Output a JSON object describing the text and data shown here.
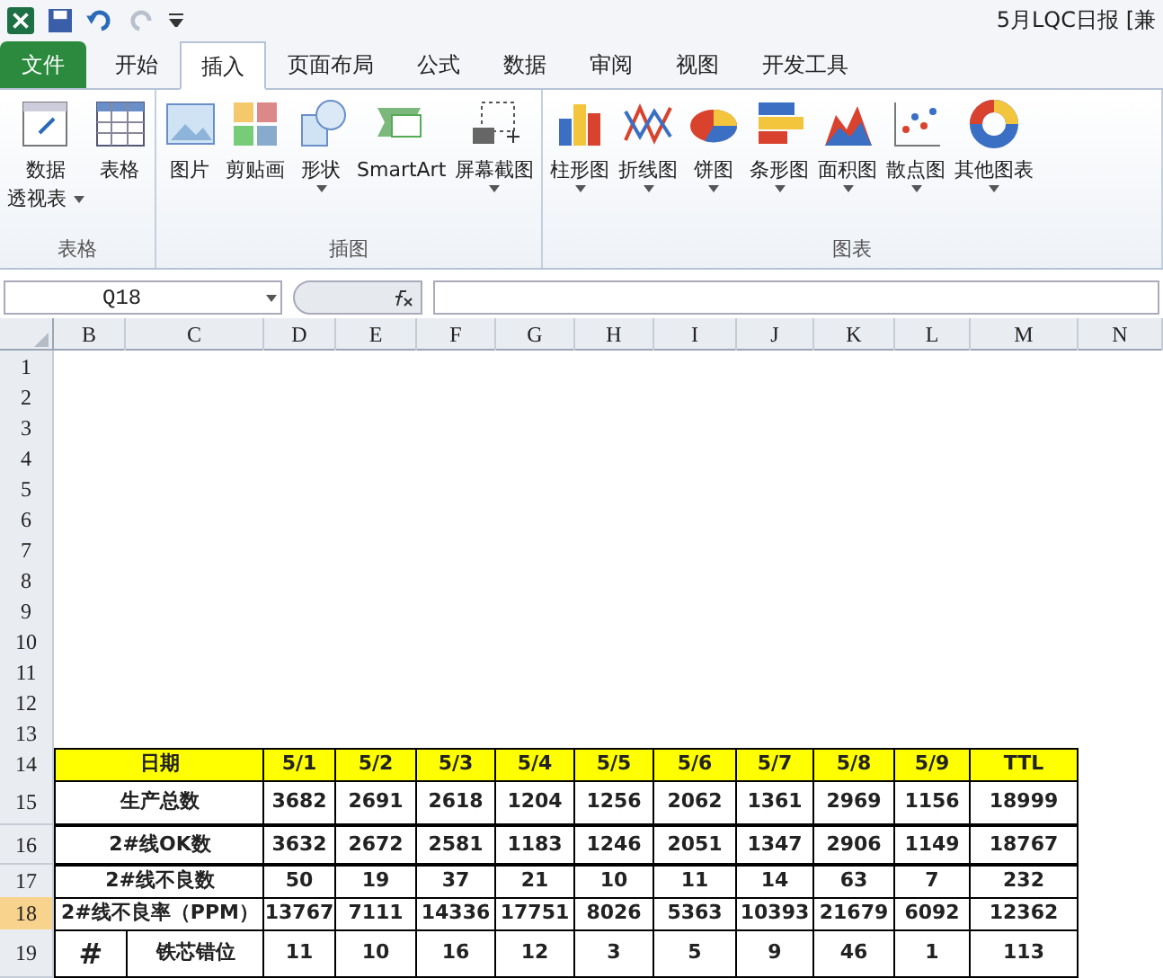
{
  "window": {
    "title": "5月LQC日报  [兼"
  },
  "tabs": [
    {
      "label": "文件",
      "kind": "file",
      "selected": false
    },
    {
      "label": "开始",
      "kind": "tab",
      "selected": false
    },
    {
      "label": "插入",
      "kind": "tab",
      "selected": true
    },
    {
      "label": "页面布局",
      "kind": "tab",
      "selected": false
    },
    {
      "label": "公式",
      "kind": "tab",
      "selected": false
    },
    {
      "label": "数据",
      "kind": "tab",
      "selected": false
    },
    {
      "label": "审阅",
      "kind": "tab",
      "selected": false
    },
    {
      "label": "视图",
      "kind": "tab",
      "selected": false
    },
    {
      "label": "开发工具",
      "kind": "tab",
      "selected": false
    }
  ],
  "ribbon_groups": [
    {
      "label": "表格",
      "items": [
        {
          "lines": [
            "数据",
            "透视表"
          ],
          "dropdown": true
        },
        {
          "lines": [
            "表格"
          ],
          "dropdown": false
        }
      ]
    },
    {
      "label": "插图",
      "items": [
        {
          "lines": [
            "图片"
          ],
          "dropdown": false
        },
        {
          "lines": [
            "剪贴画"
          ],
          "dropdown": false
        },
        {
          "lines": [
            "形状"
          ],
          "dropdown": true
        },
        {
          "lines": [
            "SmartArt"
          ],
          "dropdown": false
        },
        {
          "lines": [
            "屏幕截图"
          ],
          "dropdown": true
        }
      ]
    },
    {
      "label": "图表",
      "items": [
        {
          "lines": [
            "柱形图"
          ],
          "dropdown": true
        },
        {
          "lines": [
            "折线图"
          ],
          "dropdown": true
        },
        {
          "lines": [
            "饼图"
          ],
          "dropdown": true
        },
        {
          "lines": [
            "条形图"
          ],
          "dropdown": true
        },
        {
          "lines": [
            "面积图"
          ],
          "dropdown": true
        },
        {
          "lines": [
            "散点图"
          ],
          "dropdown": true
        },
        {
          "lines": [
            "其他图表"
          ],
          "dropdown": true
        }
      ]
    }
  ],
  "name_box": "Q18",
  "columns": [
    "B",
    "C",
    "D",
    "E",
    "F",
    "G",
    "H",
    "I",
    "J",
    "K",
    "L",
    "M",
    "N"
  ],
  "row_headers": [
    {
      "label": "1",
      "selected": false
    },
    {
      "label": "2",
      "selected": false
    },
    {
      "label": "3",
      "selected": false
    },
    {
      "label": "4",
      "selected": false
    },
    {
      "label": "5",
      "selected": false
    },
    {
      "label": "6",
      "selected": false
    },
    {
      "label": "7",
      "selected": false
    },
    {
      "label": "8",
      "selected": false
    },
    {
      "label": "9",
      "selected": false
    },
    {
      "label": "10",
      "selected": false
    },
    {
      "label": "11",
      "selected": false
    },
    {
      "label": "12",
      "selected": false
    },
    {
      "label": "13",
      "selected": false
    },
    {
      "label": "14",
      "selected": false
    },
    {
      "label": "15",
      "selected": false
    },
    {
      "label": "16",
      "selected": false
    },
    {
      "label": "17",
      "selected": false
    },
    {
      "label": "18",
      "selected": true
    },
    {
      "label": "19",
      "selected": false
    }
  ],
  "table_rows": [
    {
      "kind": "header",
      "label": "日期",
      "values": [
        "5/1",
        "5/2",
        "5/3",
        "5/4",
        "5/5",
        "5/6",
        "5/7",
        "5/8",
        "5/9",
        "TTL"
      ]
    },
    {
      "kind": "data",
      "label": "生产总数",
      "values": [
        "3682",
        "2691",
        "2618",
        "1204",
        "1256",
        "2062",
        "1361",
        "2969",
        "1156",
        "18999"
      ]
    },
    {
      "kind": "data",
      "label": "2#线OK数",
      "values": [
        "3632",
        "2672",
        "2581",
        "1183",
        "1246",
        "2051",
        "1347",
        "2906",
        "1149",
        "18767"
      ]
    },
    {
      "kind": "data",
      "label": "2#线不良数",
      "values": [
        "50",
        "19",
        "37",
        "21",
        "10",
        "11",
        "14",
        "63",
        "7",
        "232"
      ]
    },
    {
      "kind": "data",
      "label": "2#线不良率（PPM）",
      "values": [
        "13767",
        "7111",
        "14336",
        "17751",
        "8026",
        "5363",
        "10393",
        "21679",
        "6092",
        "12362"
      ]
    },
    {
      "kind": "split",
      "group": "#",
      "label": "铁芯错位",
      "values": [
        "11",
        "10",
        "16",
        "12",
        "3",
        "5",
        "9",
        "46",
        "1",
        "113"
      ]
    }
  ]
}
